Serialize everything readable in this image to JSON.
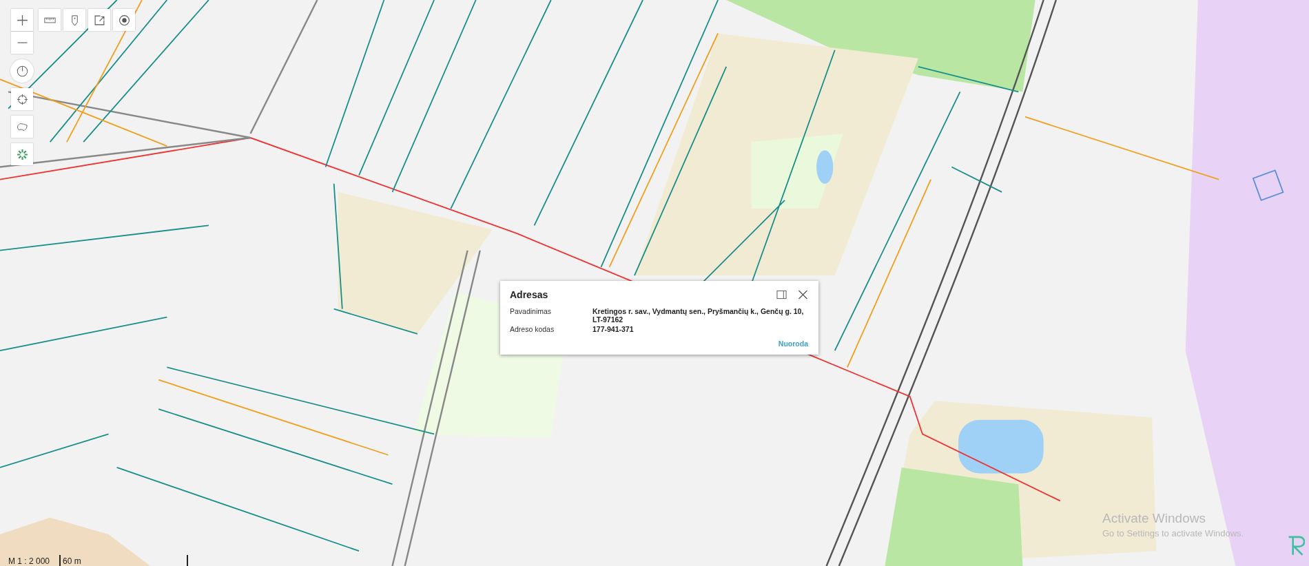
{
  "popup": {
    "title": "Adresas",
    "fields": [
      {
        "label": "Pavadinimas",
        "value": "Kretingos r. sav., Vydmantų sen., Pryšmančių k., Genčų g. 10, LT-97162"
      },
      {
        "label": "Adreso kodas",
        "value": "177-941-371"
      }
    ],
    "link": "Nuoroda"
  },
  "scale": {
    "ratio": "M 1 : 2 000",
    "distance": "60 m"
  },
  "os_notice": {
    "title": "Activate Windows",
    "text": "Go to Settings to activate Windows."
  }
}
